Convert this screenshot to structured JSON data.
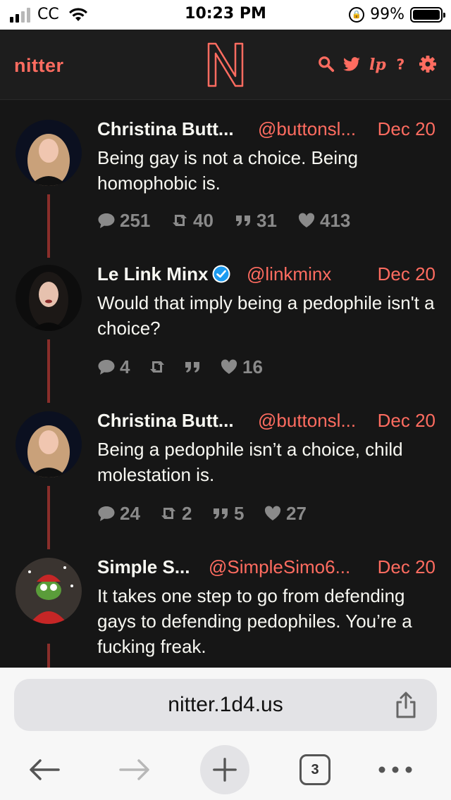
{
  "status_bar": {
    "carrier": "CC",
    "time": "10:23 PM",
    "battery": "99%",
    "battery_level": 0.99,
    "signal_bars": 2
  },
  "nav": {
    "brand": "nitter",
    "icons": [
      "search-icon",
      "twitter-bird-icon",
      "rss-icon",
      "help-icon",
      "settings-gear-icon"
    ],
    "accent": "#ff6c60"
  },
  "tweets": [
    {
      "name": "Christina Butt...",
      "handle": "@buttonsl...",
      "date": "Dec 20",
      "verified": false,
      "text": "Being gay is not a choice. Being homophobic is.",
      "replies": "251",
      "retweets": "40",
      "quotes": "31",
      "likes": "413"
    },
    {
      "name": "Le Link Minx",
      "handle": "@linkminx",
      "date": "Dec 20",
      "verified": true,
      "text": "Would that imply being a pedophile isn't a choice?",
      "replies": "4",
      "retweets": "",
      "quotes": "",
      "likes": "16"
    },
    {
      "name": "Christina Butt...",
      "handle": "@buttonsl...",
      "date": "Dec 20",
      "verified": false,
      "text": "Being a pedophile isn’t a choice, child molestation is.",
      "replies": "24",
      "retweets": "2",
      "quotes": "5",
      "likes": "27"
    },
    {
      "name": "Simple S...",
      "handle": "@SimpleSimo6...",
      "date": "Dec 20",
      "verified": false,
      "text": "It takes one step to go from defending gays to defending pedophiles. You’re a fucking freak."
    }
  ],
  "browser": {
    "url": "nitter.1d4.us",
    "tab_count": "3"
  }
}
